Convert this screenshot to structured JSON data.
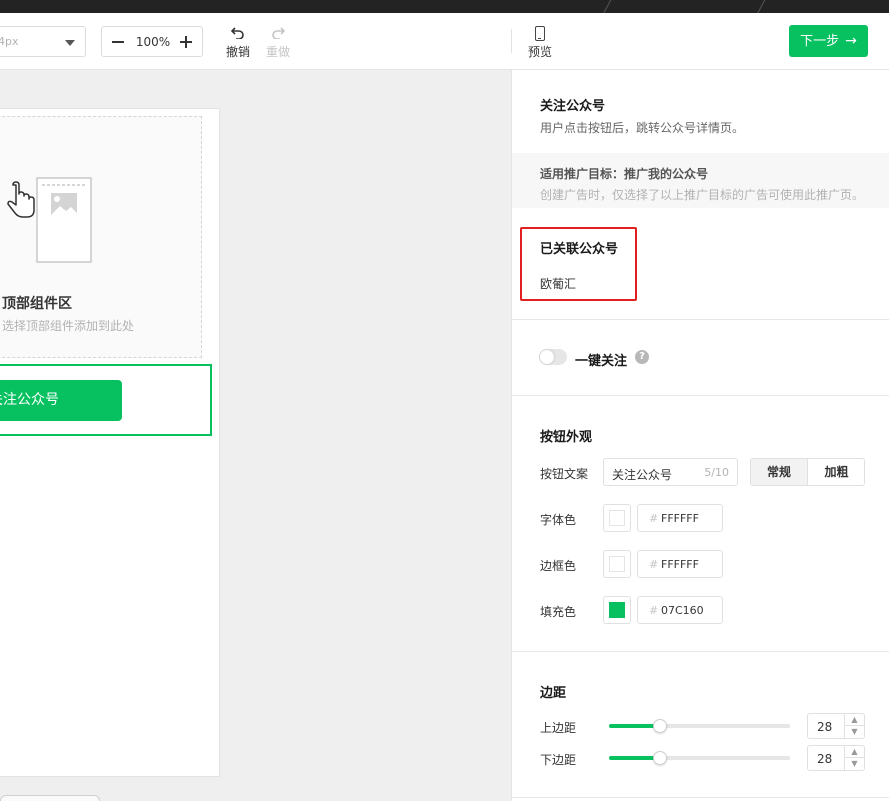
{
  "toolbar": {
    "font_size_value": "4px",
    "zoom_value": "100%",
    "undo_label": "撤销",
    "redo_label": "重做",
    "preview_label": "预览",
    "next_label": "下一步"
  },
  "canvas": {
    "top_area_title": "顶部组件区",
    "top_area_hint": "选择顶部组件添加到此处",
    "follow_button_text": "关注公众号"
  },
  "panel": {
    "title": "关注公众号",
    "description": "用户点击按钮后，跳转公众号详情页。",
    "goal_title": "适用推广目标：推广我的公众号",
    "goal_desc": "创建广告时，仅选择了以上推广目标的广告可使用此推广页。",
    "linked_title": "已关联公众号",
    "linked_name": "欧葡汇",
    "one_click_label": "一键关注",
    "one_click_enabled": false,
    "help_glyph": "?",
    "appearance_title": "按钮外观",
    "button_text_label": "按钮文案",
    "button_text_value": "关注公众号",
    "button_text_count": "5/10",
    "style_normal": "常规",
    "style_bold": "加粗",
    "font_color_label": "字体色",
    "font_color": "FFFFFF",
    "border_color_label": "边框色",
    "border_color": "FFFFFF",
    "fill_color_label": "填充色",
    "fill_color": "07C160",
    "hash": "#",
    "margin_title": "边距",
    "top_margin_label": "上边距",
    "top_margin_value": "28",
    "top_margin_fraction": 0.28,
    "bottom_margin_label": "下边距",
    "bottom_margin_value": "28",
    "bottom_margin_fraction": 0.28
  },
  "colors": {
    "accent": "#07c160",
    "highlight_box": "#e02020"
  }
}
